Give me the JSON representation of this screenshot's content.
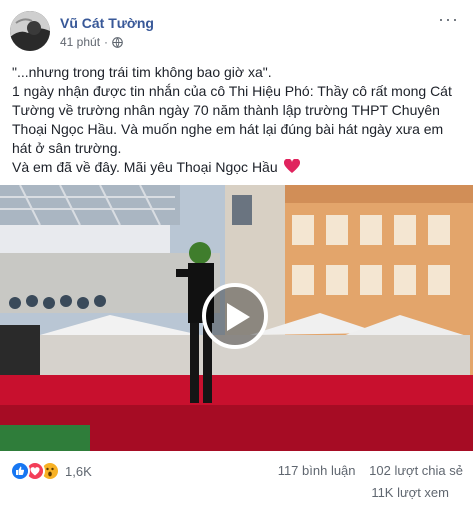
{
  "post": {
    "author": "Vũ Cát Tường",
    "time": "41 phút",
    "separator": "·",
    "privacy_icon": "globe-icon",
    "menu_icon": "more-horizontal-icon",
    "text_lines": [
      "\"...nhưng trong trái tim không bao giờ xa\".",
      "1 ngày nhận được tin nhắn của cô Thi Hiệu Phó: Thầy cô rất mong Cát Tường về trường nhân ngày 70 năm thành lập trường THPT Chuyên Thoại Ngọc Hầu. Và muốn nghe em hát lại đúng bài hát ngày xưa em hát ở sân trường.",
      "Và em đã về đây. Mãi yêu Thoại Ngọc Hầu"
    ],
    "heart_emoji_color": "#e0245e"
  },
  "video": {
    "play_icon": "play-icon"
  },
  "footer": {
    "reaction_icons": [
      "like-icon",
      "love-icon",
      "wow-icon"
    ],
    "reaction_count": "1,6K",
    "comments": "117 bình luận",
    "shares": "102 lượt chia sẻ",
    "views": "11K lượt xem"
  },
  "colors": {
    "author_link": "#385898",
    "secondary_text": "#616770",
    "like_blue": "#1877f2",
    "love_red": "#f33e58",
    "wow_yellow": "#f7b125"
  }
}
